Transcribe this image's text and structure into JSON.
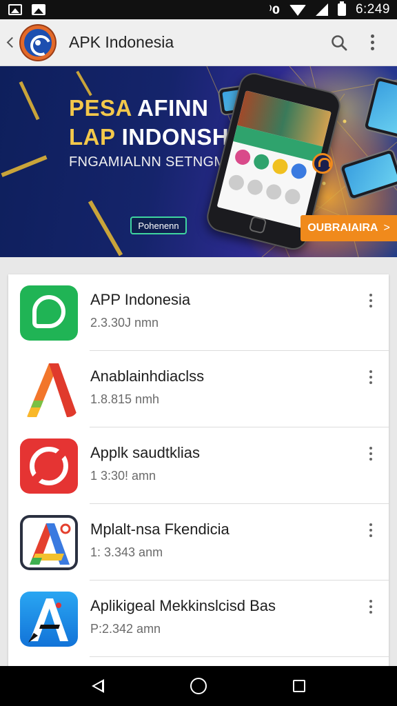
{
  "status_bar": {
    "time": "6:249",
    "vibrate_glyph": "⁾0",
    "icons": [
      "gallery-icon",
      "photo-icon",
      "vibrate-icon",
      "wifi-icon",
      "signal-icon",
      "battery-icon"
    ]
  },
  "app_bar": {
    "title": "APK Indonesia",
    "icons": [
      "back-arrow-icon",
      "app-logo",
      "search-icon",
      "more-vert-icon"
    ]
  },
  "banner": {
    "line1_gold": "PESA ",
    "line1_white": "AFINN",
    "line2_gold": "LAP",
    "line2_white": "INDONSHIA",
    "subtitle": "FNGAMIALNN SETNGMIAL",
    "promo_label": "Pohenenn",
    "cta_label": "OUBRAIAIRA",
    "cta_chevron": ">"
  },
  "apps": [
    {
      "title": "APP Indonesia",
      "subtitle": "2.3.30J nmn",
      "icon": "green-chat-icon"
    },
    {
      "title": "Anablainhdiaclss",
      "subtitle": "1.8.815 nmh",
      "icon": "orange-a-icon"
    },
    {
      "title": "Applk saudtklias",
      "subtitle": "1 3:30! amn",
      "icon": "red-circle-icon"
    },
    {
      "title": "Mplalt-nsa Fkendicia",
      "subtitle": "1: 3.343 anm",
      "icon": "multicolor-a-icon"
    },
    {
      "title": "Aplikigeal Mekkinslcisd Bas",
      "subtitle": "P:2.342 amn",
      "icon": "blue-a-icon"
    }
  ],
  "nav_bar": {
    "icons": [
      "nav-back-icon",
      "nav-home-icon",
      "nav-recent-icon"
    ]
  },
  "colors": {
    "accent_orange": "#f08a1c",
    "banner_gold": "#f3c84b",
    "banner_navy": "#15246b"
  }
}
